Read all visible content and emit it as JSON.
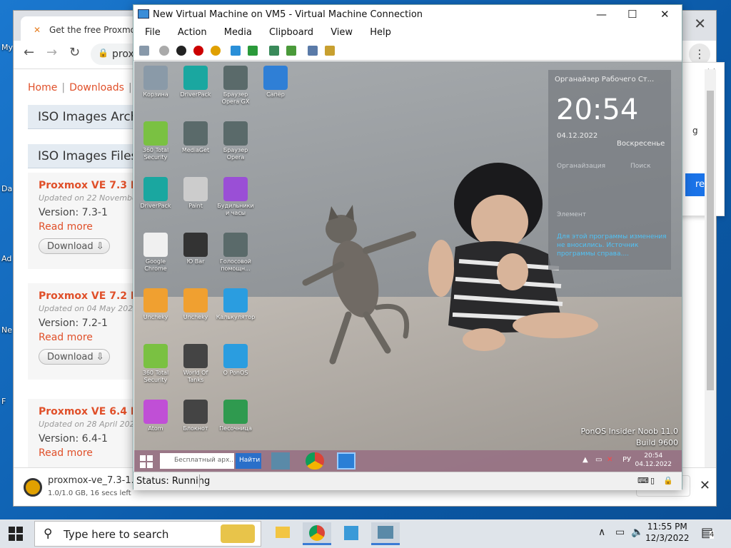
{
  "host_desktop": {
    "icons": [
      "My",
      "Da",
      "Ad",
      "Ne",
      "F"
    ]
  },
  "chrome": {
    "tab_title": "Get the free Proxmox V",
    "omnibox_text": "prox",
    "breadcrumb": {
      "home": "Home",
      "downloads": "Downloads"
    },
    "sections": [
      "ISO Images Archive",
      "ISO Images Files"
    ],
    "cards": [
      {
        "title": "Proxmox VE 7.3 ISO",
        "updated": "Updated on 22 November",
        "version": "Version: 7.3-1",
        "read_more": "Read more",
        "download": "Download"
      },
      {
        "title": "Proxmox VE 7.2 ISO",
        "updated": "Updated on 04 May 2022",
        "version": "Version: 7.2-1",
        "read_more": "Read more",
        "download": "Download"
      },
      {
        "title": "Proxmox VE 6.4 ISO",
        "updated": "Updated on 28 April 2021",
        "version": "Version: 6.4-1",
        "read_more": "Read more"
      }
    ],
    "popup": {
      "text": "g",
      "button": "re"
    },
    "download_bar": {
      "filename": "proxmox-ve_7.3-1.iso",
      "size": "1.0/1.0 GB, 16 secs left"
    }
  },
  "vm": {
    "title": "New Virtual Machine on VM5 - Virtual Machine Connection",
    "menu": [
      "File",
      "Action",
      "Media",
      "Clipboard",
      "View",
      "Help"
    ],
    "status": "Status: Running",
    "guest": {
      "icons": [
        {
          "label": "Корзина",
          "color": "#8a9aa8"
        },
        {
          "label": "DriverPack",
          "color": "#1aa7a0"
        },
        {
          "label": "Браузер Opera GX",
          "color": "#5a6a6a"
        },
        {
          "label": "Сапёр",
          "color": "#2f7fd6"
        },
        {
          "label": "360 Total Security",
          "color": "#7ac142"
        },
        {
          "label": "MediaGet",
          "color": "#5a6a6a"
        },
        {
          "label": "Браузер Opera",
          "color": "#5a6a6a"
        },
        {
          "label": "DriverPack",
          "color": "#1aa7a0"
        },
        {
          "label": "Paint",
          "color": "#ccc"
        },
        {
          "label": "Будильники и часы",
          "color": "#9a4fd6"
        },
        {
          "label": "Google Chrome",
          "color": "#f0f0f0"
        },
        {
          "label": "Ю Bar",
          "color": "#333"
        },
        {
          "label": "Голосовой помощн...",
          "color": "#5a6a6a"
        },
        {
          "label": "Uncheky",
          "color": "#f0a030"
        },
        {
          "label": "Uncheky",
          "color": "#f0a030"
        },
        {
          "label": "Калькулятор",
          "color": "#2a9de0"
        },
        {
          "label": "360 Total Security",
          "color": "#7ac142"
        },
        {
          "label": "World Of Tanks",
          "color": "#444"
        },
        {
          "label": "O PonOS",
          "color": "#2a9de0"
        },
        {
          "label": "Atom",
          "color": "#c04fd6"
        },
        {
          "label": "Блокнот",
          "color": "#444"
        },
        {
          "label": "Песочница",
          "color": "#2f9a4f"
        }
      ],
      "gadget": {
        "title": "Органайзер Рабочего Ст...",
        "time": "20:54",
        "date": "04.12.2022",
        "day": "Воскресенье",
        "row1a": "Органайзация",
        "row1b": "Поиск",
        "row2": "Элемент",
        "links": "Для этой программы изменения не вносились. Источник программы справа...."
      },
      "watermark": [
        "PonOS Insider Noob 11.0",
        "Build 9600"
      ],
      "taskbar": {
        "search": "Бесплатный арх...",
        "find": "Найти",
        "lang": "РУ",
        "time": "20:54",
        "date": "04.12.2022"
      }
    }
  },
  "host_taskbar": {
    "search_placeholder": "Type here to search",
    "time": "11:55 PM",
    "date": "12/3/2022",
    "notifications": "4"
  }
}
